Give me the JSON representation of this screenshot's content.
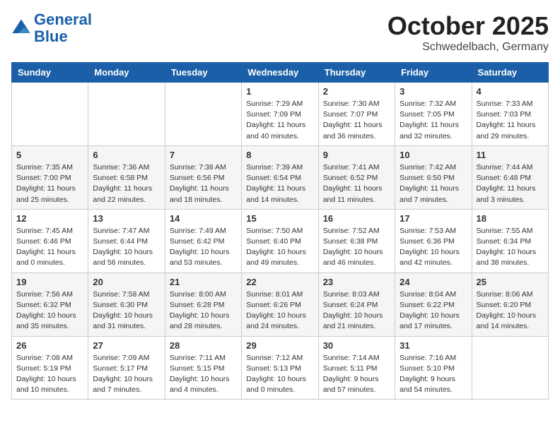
{
  "header": {
    "logo_line1": "General",
    "logo_line2": "Blue",
    "month": "October 2025",
    "location": "Schwedelbach, Germany"
  },
  "weekdays": [
    "Sunday",
    "Monday",
    "Tuesday",
    "Wednesday",
    "Thursday",
    "Friday",
    "Saturday"
  ],
  "weeks": [
    [
      {
        "day": "",
        "info": ""
      },
      {
        "day": "",
        "info": ""
      },
      {
        "day": "",
        "info": ""
      },
      {
        "day": "1",
        "info": "Sunrise: 7:29 AM\nSunset: 7:09 PM\nDaylight: 11 hours\nand 40 minutes."
      },
      {
        "day": "2",
        "info": "Sunrise: 7:30 AM\nSunset: 7:07 PM\nDaylight: 11 hours\nand 36 minutes."
      },
      {
        "day": "3",
        "info": "Sunrise: 7:32 AM\nSunset: 7:05 PM\nDaylight: 11 hours\nand 32 minutes."
      },
      {
        "day": "4",
        "info": "Sunrise: 7:33 AM\nSunset: 7:03 PM\nDaylight: 11 hours\nand 29 minutes."
      }
    ],
    [
      {
        "day": "5",
        "info": "Sunrise: 7:35 AM\nSunset: 7:00 PM\nDaylight: 11 hours\nand 25 minutes."
      },
      {
        "day": "6",
        "info": "Sunrise: 7:36 AM\nSunset: 6:58 PM\nDaylight: 11 hours\nand 22 minutes."
      },
      {
        "day": "7",
        "info": "Sunrise: 7:38 AM\nSunset: 6:56 PM\nDaylight: 11 hours\nand 18 minutes."
      },
      {
        "day": "8",
        "info": "Sunrise: 7:39 AM\nSunset: 6:54 PM\nDaylight: 11 hours\nand 14 minutes."
      },
      {
        "day": "9",
        "info": "Sunrise: 7:41 AM\nSunset: 6:52 PM\nDaylight: 11 hours\nand 11 minutes."
      },
      {
        "day": "10",
        "info": "Sunrise: 7:42 AM\nSunset: 6:50 PM\nDaylight: 11 hours\nand 7 minutes."
      },
      {
        "day": "11",
        "info": "Sunrise: 7:44 AM\nSunset: 6:48 PM\nDaylight: 11 hours\nand 3 minutes."
      }
    ],
    [
      {
        "day": "12",
        "info": "Sunrise: 7:45 AM\nSunset: 6:46 PM\nDaylight: 11 hours\nand 0 minutes."
      },
      {
        "day": "13",
        "info": "Sunrise: 7:47 AM\nSunset: 6:44 PM\nDaylight: 10 hours\nand 56 minutes."
      },
      {
        "day": "14",
        "info": "Sunrise: 7:49 AM\nSunset: 6:42 PM\nDaylight: 10 hours\nand 53 minutes."
      },
      {
        "day": "15",
        "info": "Sunrise: 7:50 AM\nSunset: 6:40 PM\nDaylight: 10 hours\nand 49 minutes."
      },
      {
        "day": "16",
        "info": "Sunrise: 7:52 AM\nSunset: 6:38 PM\nDaylight: 10 hours\nand 46 minutes."
      },
      {
        "day": "17",
        "info": "Sunrise: 7:53 AM\nSunset: 6:36 PM\nDaylight: 10 hours\nand 42 minutes."
      },
      {
        "day": "18",
        "info": "Sunrise: 7:55 AM\nSunset: 6:34 PM\nDaylight: 10 hours\nand 38 minutes."
      }
    ],
    [
      {
        "day": "19",
        "info": "Sunrise: 7:56 AM\nSunset: 6:32 PM\nDaylight: 10 hours\nand 35 minutes."
      },
      {
        "day": "20",
        "info": "Sunrise: 7:58 AM\nSunset: 6:30 PM\nDaylight: 10 hours\nand 31 minutes."
      },
      {
        "day": "21",
        "info": "Sunrise: 8:00 AM\nSunset: 6:28 PM\nDaylight: 10 hours\nand 28 minutes."
      },
      {
        "day": "22",
        "info": "Sunrise: 8:01 AM\nSunset: 6:26 PM\nDaylight: 10 hours\nand 24 minutes."
      },
      {
        "day": "23",
        "info": "Sunrise: 8:03 AM\nSunset: 6:24 PM\nDaylight: 10 hours\nand 21 minutes."
      },
      {
        "day": "24",
        "info": "Sunrise: 8:04 AM\nSunset: 6:22 PM\nDaylight: 10 hours\nand 17 minutes."
      },
      {
        "day": "25",
        "info": "Sunrise: 8:06 AM\nSunset: 6:20 PM\nDaylight: 10 hours\nand 14 minutes."
      }
    ],
    [
      {
        "day": "26",
        "info": "Sunrise: 7:08 AM\nSunset: 5:19 PM\nDaylight: 10 hours\nand 10 minutes."
      },
      {
        "day": "27",
        "info": "Sunrise: 7:09 AM\nSunset: 5:17 PM\nDaylight: 10 hours\nand 7 minutes."
      },
      {
        "day": "28",
        "info": "Sunrise: 7:11 AM\nSunset: 5:15 PM\nDaylight: 10 hours\nand 4 minutes."
      },
      {
        "day": "29",
        "info": "Sunrise: 7:12 AM\nSunset: 5:13 PM\nDaylight: 10 hours\nand 0 minutes."
      },
      {
        "day": "30",
        "info": "Sunrise: 7:14 AM\nSunset: 5:11 PM\nDaylight: 9 hours\nand 57 minutes."
      },
      {
        "day": "31",
        "info": "Sunrise: 7:16 AM\nSunset: 5:10 PM\nDaylight: 9 hours\nand 54 minutes."
      },
      {
        "day": "",
        "info": ""
      }
    ]
  ]
}
